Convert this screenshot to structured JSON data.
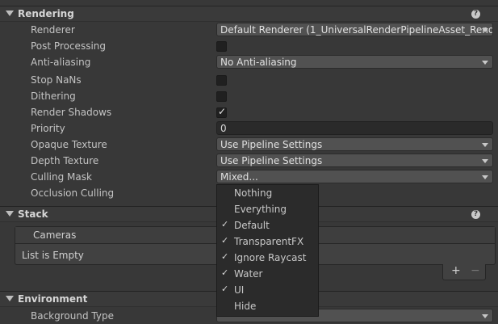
{
  "rendering": {
    "title": "Rendering",
    "help": "?",
    "rows": {
      "renderer": {
        "label": "Renderer",
        "value": "Default Renderer (1_UniversalRenderPipelineAsset_Rende"
      },
      "post_processing": {
        "label": "Post Processing",
        "checked": false
      },
      "anti_aliasing": {
        "label": "Anti-aliasing",
        "value": "No Anti-aliasing"
      },
      "stop_nans": {
        "label": "Stop NaNs",
        "checked": false
      },
      "dithering": {
        "label": "Dithering",
        "checked": false
      },
      "render_shadows": {
        "label": "Render Shadows",
        "checked": true,
        "check_glyph": "✓"
      },
      "priority": {
        "label": "Priority",
        "value": "0"
      },
      "opaque_texture": {
        "label": "Opaque Texture",
        "value": "Use Pipeline Settings"
      },
      "depth_texture": {
        "label": "Depth Texture",
        "value": "Use Pipeline Settings"
      },
      "culling_mask": {
        "label": "Culling Mask",
        "value": "Mixed..."
      },
      "occlusion_culling": {
        "label": "Occlusion Culling"
      }
    }
  },
  "stack": {
    "title": "Stack",
    "help": "?",
    "list_header": "Cameras",
    "list_empty": "List is Empty",
    "add": "+",
    "remove": "−"
  },
  "environment": {
    "title": "Environment",
    "background_type_label": "Background Type"
  },
  "culling_popup": {
    "items": [
      {
        "label": "Nothing",
        "checked": false
      },
      {
        "label": "Everything",
        "checked": false
      },
      {
        "label": "Default",
        "checked": true
      },
      {
        "label": "TransparentFX",
        "checked": true
      },
      {
        "label": "Ignore Raycast",
        "checked": true
      },
      {
        "label": "Water",
        "checked": true
      },
      {
        "label": "UI",
        "checked": true
      },
      {
        "label": "Hide",
        "checked": false
      }
    ],
    "check_glyph": "✓"
  },
  "colors": {
    "background": "#383838",
    "field": "#515151",
    "popup": "#2b2b2b"
  }
}
